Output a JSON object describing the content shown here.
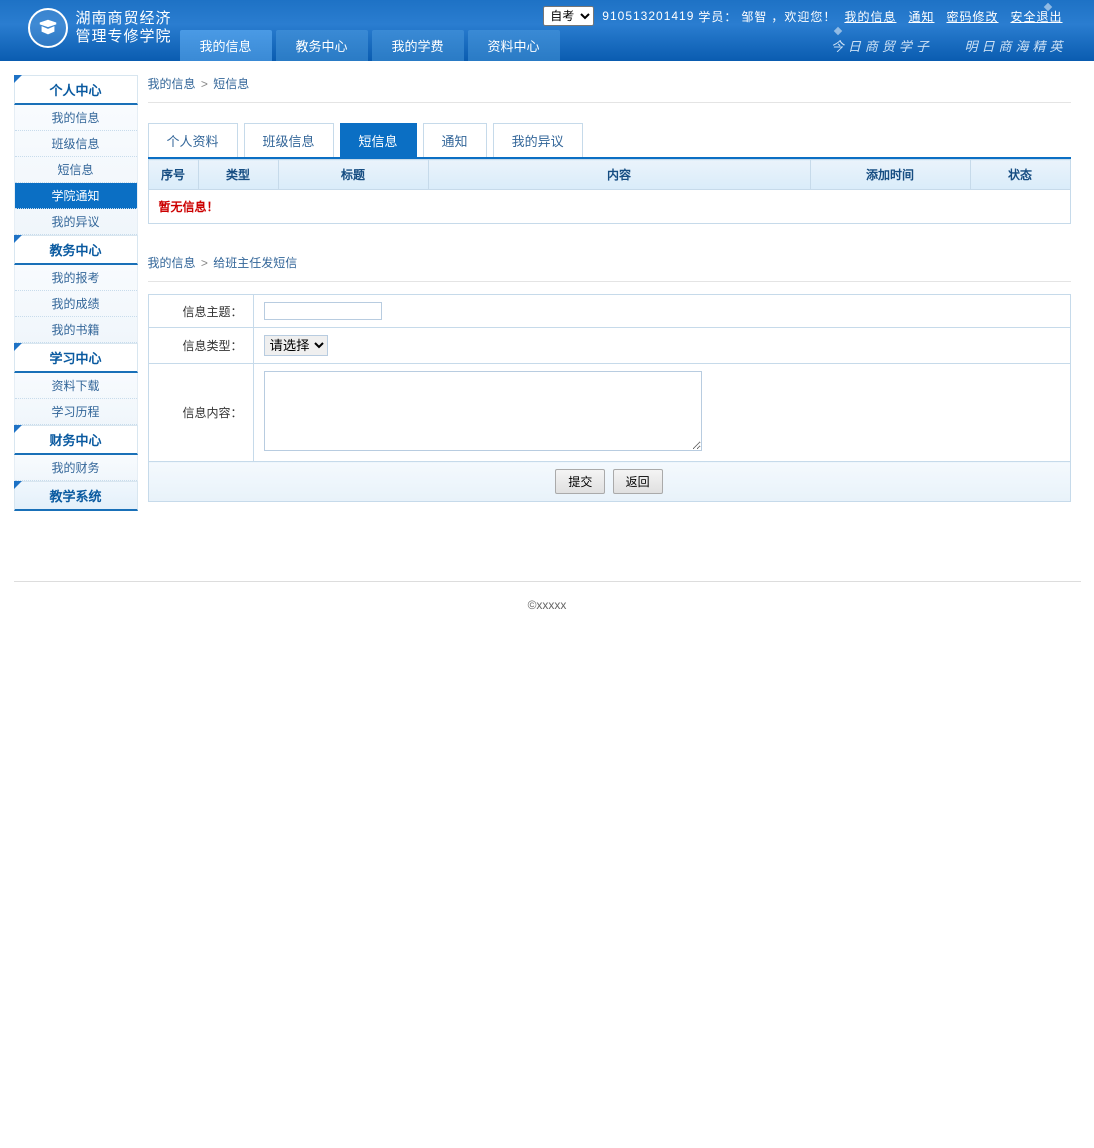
{
  "header": {
    "logo_line1": "湖南商贸经济",
    "logo_line2": "管理专修学院",
    "select_value": "自考",
    "student_id": "910513201419",
    "greet_prefix": "学员：",
    "student_name": "邹智",
    "greet_suffix": "，欢迎您！",
    "links": {
      "myinfo": "我的信息",
      "notice": "通知",
      "pwd": "密码修改",
      "logout": "安全退出"
    },
    "slogan1": "今日商贸学子",
    "slogan2": "明日商海精英"
  },
  "main_nav": [
    "我的信息",
    "教务中心",
    "我的学费",
    "资料中心"
  ],
  "sidebar": [
    {
      "title": "个人中心",
      "items": [
        "我的信息",
        "班级信息",
        "短信息",
        "学院通知",
        "我的异议"
      ],
      "active_index": 3
    },
    {
      "title": "教务中心",
      "items": [
        "我的报考",
        "我的成绩",
        "我的书籍"
      ]
    },
    {
      "title": "学习中心",
      "items": [
        "资料下载",
        "学习历程"
      ]
    },
    {
      "title": "财务中心",
      "items": [
        "我的财务"
      ]
    },
    {
      "title": "教学系统",
      "items": []
    }
  ],
  "breadcrumb1": {
    "a": "我的信息",
    "sep": ">",
    "b": "短信息"
  },
  "tabs": [
    "个人资料",
    "班级信息",
    "短信息",
    "通知",
    "我的异议"
  ],
  "tabs_active_index": 2,
  "table_cols": [
    "序号",
    "类型",
    "标题",
    "内容",
    "添加时间",
    "状态"
  ],
  "no_data": "暂无信息！",
  "breadcrumb2": {
    "a": "我的信息",
    "sep": ">",
    "b": "给班主任发短信"
  },
  "form": {
    "subject_label": "信息主题：",
    "subject_value": "",
    "type_label": "信息类型：",
    "type_selected": "请选择",
    "content_label": "信息内容：",
    "content_value": "",
    "submit": "提交",
    "back": "返回"
  },
  "footer": "©xxxxx"
}
